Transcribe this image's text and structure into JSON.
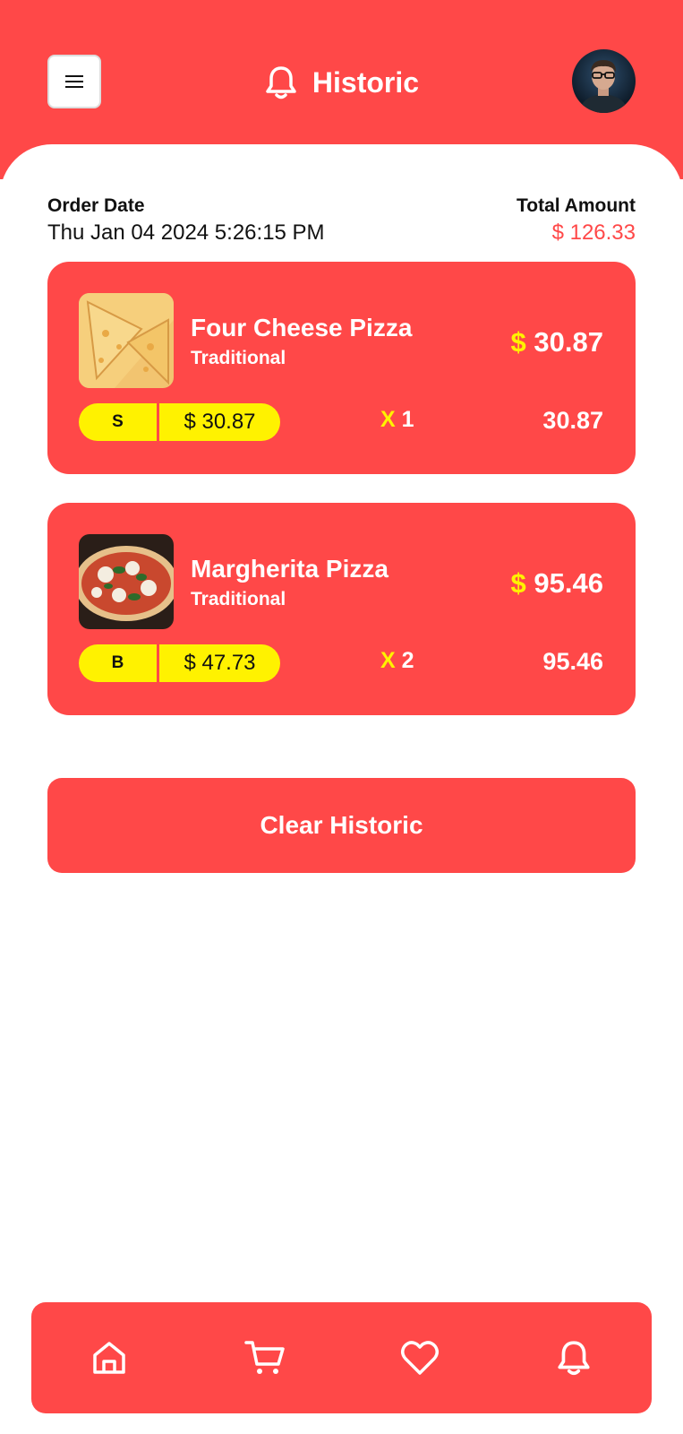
{
  "header": {
    "title": "Historic",
    "menu_icon": "hamburger-icon",
    "title_icon": "bell-icon",
    "avatar_icon": "user-avatar"
  },
  "order": {
    "date_label": "Order Date",
    "date_value": "Thu Jan 04 2024 5:26:15 PM",
    "total_label": "Total Amount",
    "total_value": "$ 126.33"
  },
  "items": [
    {
      "name": "Four Cheese Pizza",
      "type": "Traditional",
      "currency": "$",
      "price": "30.87",
      "size": "S",
      "unit_price": "$ 30.87",
      "qty_x": "X",
      "qty": "1",
      "line_total": "30.87",
      "image_icon": "four-cheese-pizza-image"
    },
    {
      "name": "Margherita Pizza",
      "type": "Traditional",
      "currency": "$",
      "price": "95.46",
      "size": "B",
      "unit_price": "$ 47.73",
      "qty_x": "X",
      "qty": "2",
      "line_total": "95.46",
      "image_icon": "margherita-pizza-image"
    }
  ],
  "actions": {
    "clear_label": "Clear Historic"
  },
  "bottom_nav": {
    "items": [
      "home-icon",
      "cart-icon",
      "heart-icon",
      "bell-icon"
    ]
  },
  "colors": {
    "accent": "#ff4848",
    "highlight": "#fff200",
    "text": "#111111",
    "background": "#ffffff"
  }
}
